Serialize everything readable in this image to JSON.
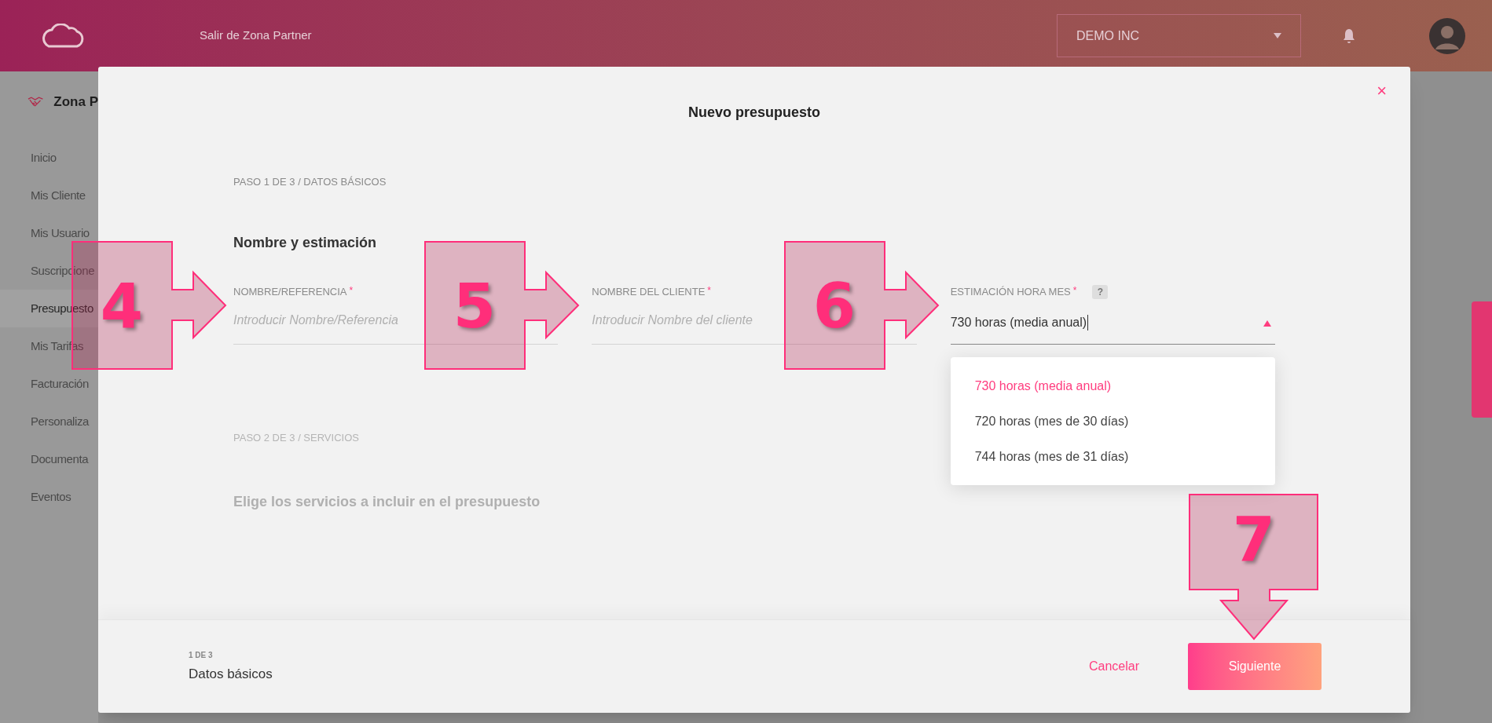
{
  "header": {
    "exit_link": "Salir de Zona Partner",
    "account_select": "DEMO INC"
  },
  "sidebar": {
    "title": "Zona P",
    "items": [
      {
        "label": "Inicio",
        "selected": false
      },
      {
        "label": "Mis Cliente",
        "selected": false
      },
      {
        "label": "Mis Usuario",
        "selected": false
      },
      {
        "label": "Suscripcione",
        "selected": false
      },
      {
        "label": "Presupuesto",
        "selected": true
      },
      {
        "label": "Mis Tarifas",
        "selected": false
      },
      {
        "label": "Facturación",
        "selected": false
      },
      {
        "label": "Personaliza",
        "selected": false
      },
      {
        "label": "Documenta",
        "selected": false
      },
      {
        "label": "Eventos",
        "selected": false
      }
    ]
  },
  "modal": {
    "title": "Nuevo presupuesto",
    "close": "×",
    "steps": [
      {
        "heading": "PASO 1 DE 3 / DATOS BÁSICOS",
        "title": "Nombre y estimación",
        "disabled": false,
        "fields": [
          {
            "label": "NOMBRE/REFERENCIA",
            "required_mark": "*",
            "placeholder": "Introducir Nombre/Referencia"
          },
          {
            "label": "NOMBRE DEL CLIENTE",
            "required_mark": "*",
            "placeholder": "Introducir Nombre del cliente"
          },
          {
            "label": "ESTIMACIÓN HORA MES",
            "required_mark": "*",
            "help": "?",
            "value": "730 horas (media anual)",
            "expanded": true,
            "options": [
              {
                "label": "730 horas (media anual)",
                "selected": true
              },
              {
                "label": "720 horas (mes de 30 días)",
                "selected": false
              },
              {
                "label": "744 horas (mes de 31 días)",
                "selected": false
              }
            ]
          }
        ]
      },
      {
        "heading": "PASO 2 DE 3 / SERVICIOS",
        "title": "Elige los servicios a incluir en el presupuesto",
        "disabled": true
      }
    ],
    "footer": {
      "step_count": "1 DE 3",
      "step_name": "Datos básicos",
      "cancel": "Cancelar",
      "next": "Siguiente"
    }
  },
  "annotations": [
    {
      "label": "4",
      "kind": "arrow_right"
    },
    {
      "label": "5",
      "kind": "arrow_right"
    },
    {
      "label": "6",
      "kind": "arrow_right"
    },
    {
      "label": "7",
      "kind": "arrow_down"
    }
  ]
}
